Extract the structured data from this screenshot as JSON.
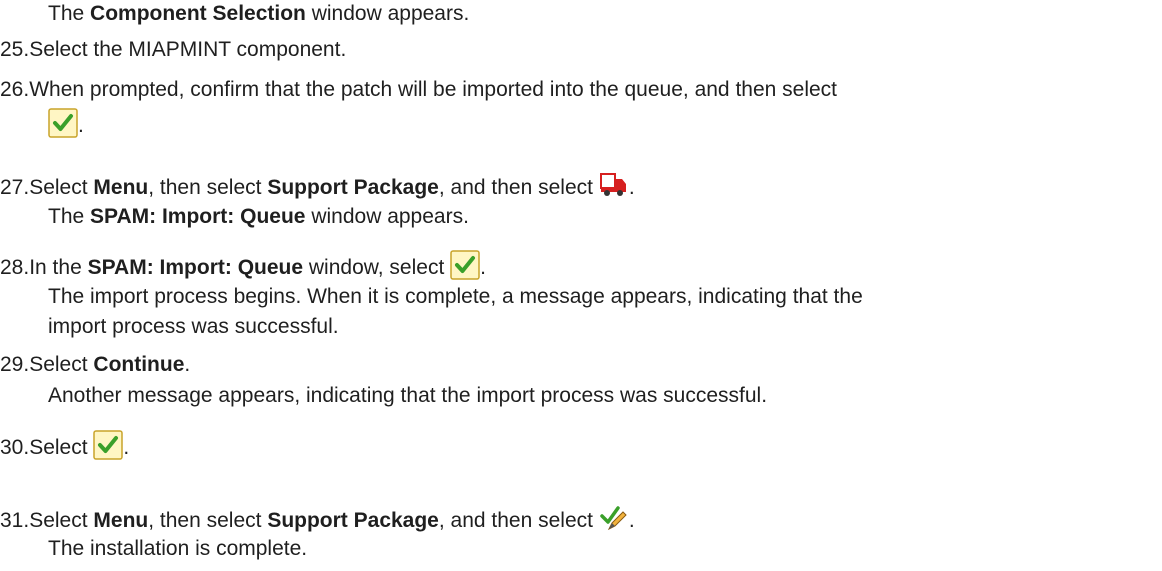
{
  "intro": {
    "prefix": "The ",
    "bold": "Component Selection",
    "suffix": " window appears."
  },
  "steps": {
    "s25": {
      "number": "25.",
      "text": "Select the MIAPMINT component."
    },
    "s26": {
      "number": "26.",
      "text": "When prompted, confirm that the patch will be imported into the queue, and then select",
      "icon": "green-checkmark-icon",
      "end": "."
    },
    "s27": {
      "number": "27.",
      "t1": "Select ",
      "b1": "Menu",
      "t2": ", then select ",
      "b2": "Support Package",
      "t3": ", and then select ",
      "icon": "truck-icon",
      "end": ".",
      "sub_bold": "SPAM: Import: Queue",
      "sub_prefix": "The ",
      "sub_suffix": " window appears."
    },
    "s28": {
      "number": "28.",
      "t1": "In the ",
      "b1": "SPAM: Import: Queue",
      "t2": " window, select ",
      "icon": "green-checkmark-icon",
      "end": ".",
      "sub1": "The import process begins. When it is complete, a message appears, indicating that the",
      "sub2": "import process was successful."
    },
    "s29": {
      "number": "29.",
      "t1": "Select ",
      "b1": "Continue",
      "end": ".",
      "sub": "Another message appears, indicating that the import process was successful."
    },
    "s30": {
      "number": "30.",
      "t1": "Select ",
      "icon": "green-checkmark-icon",
      "end": "."
    },
    "s31": {
      "number": "31.",
      "t1": "Select ",
      "b1": "Menu",
      "t2": ", then select ",
      "b2": "Support Package",
      "t3": ", and then select ",
      "icon": "checkmark-pencil-icon",
      "end": ".",
      "sub": "The installation is complete."
    }
  },
  "colors": {
    "check_green": "#3aa02a",
    "check_bg": "#fff6c4",
    "check_border": "#c9a42a",
    "truck_red": "#d62020"
  }
}
